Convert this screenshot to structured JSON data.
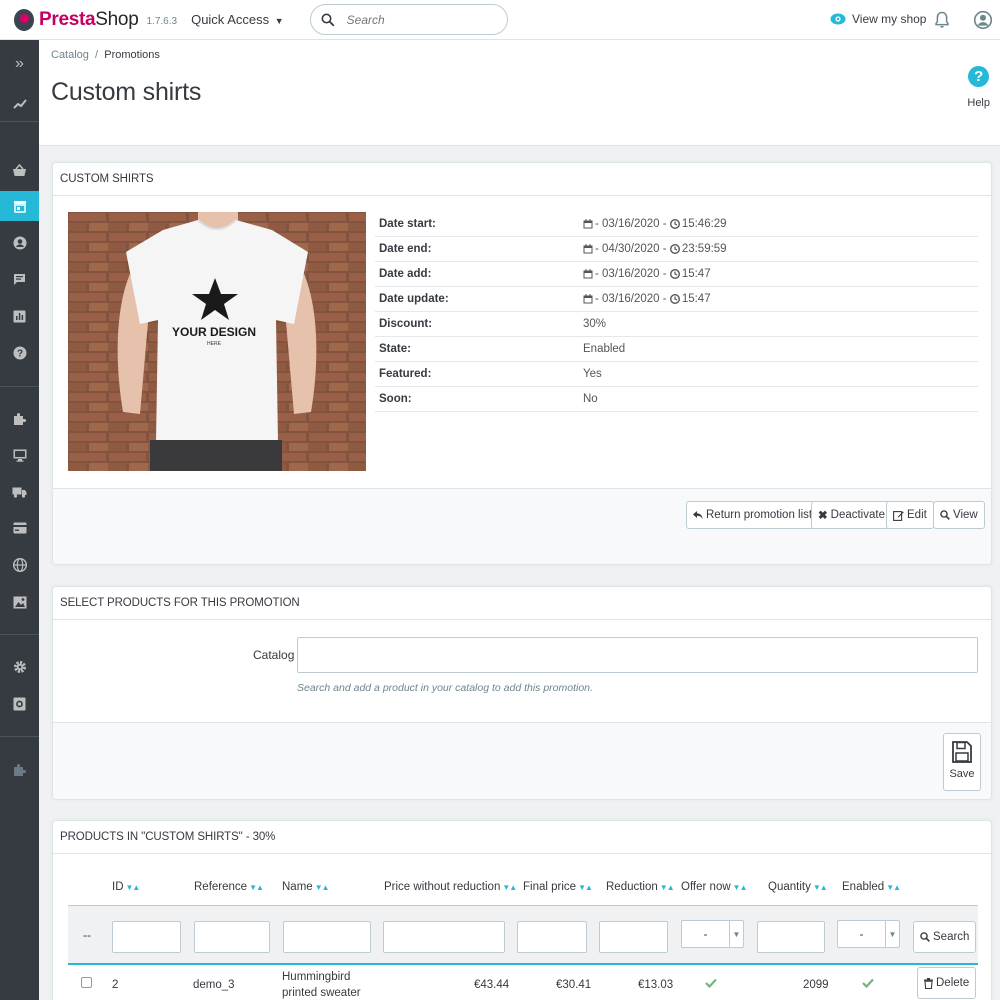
{
  "header": {
    "logo_prefix": "Presta",
    "logo_suffix": "Shop",
    "version": "1.7.6.3",
    "quick_access": "Quick Access",
    "search_placeholder": "Search",
    "view_shop": "View my shop"
  },
  "sidebar": {
    "items": [
      {
        "icon": "chevrons-right-icon"
      },
      {
        "icon": "dashboard-trend-icon"
      },
      {
        "icon": "orders-basket-icon"
      },
      {
        "icon": "catalog-store-icon",
        "active": true
      },
      {
        "icon": "customers-user-icon"
      },
      {
        "icon": "messages-chat-icon"
      },
      {
        "icon": "stats-chart-icon"
      },
      {
        "icon": "help-question-icon"
      },
      {
        "icon": "modules-puzzle-icon"
      },
      {
        "icon": "design-monitor-icon"
      },
      {
        "icon": "shipping-truck-icon"
      },
      {
        "icon": "payment-card-icon"
      },
      {
        "icon": "international-globe-icon"
      },
      {
        "icon": "media-image-icon"
      },
      {
        "icon": "settings-gear-icon"
      },
      {
        "icon": "advanced-settings-icon"
      },
      {
        "icon": "extension-puzzle-icon"
      }
    ]
  },
  "page": {
    "breadcrumb_parent": "Catalog",
    "breadcrumb_sep": "/",
    "breadcrumb_current": "Promotions",
    "title": "Custom shirts",
    "help_label": "Help"
  },
  "promotion": {
    "heading": "CUSTOM SHIRTS",
    "image_text_main": "YOUR DESIGN",
    "image_text_sub": "HERE",
    "rows": [
      {
        "label": "Date start:",
        "date": "- 03/16/2020 -",
        "time": "15:46:29"
      },
      {
        "label": "Date end:",
        "date": "- 04/30/2020 -",
        "time": "23:59:59"
      },
      {
        "label": "Date add:",
        "date": "- 03/16/2020 -",
        "time": "15:47"
      },
      {
        "label": "Date update:",
        "date": "- 03/16/2020 -",
        "time": "15:47"
      },
      {
        "label": "Discount:",
        "value": "30%"
      },
      {
        "label": "State:",
        "value": "Enabled"
      },
      {
        "label": "Featured:",
        "value": "Yes"
      },
      {
        "label": "Soon:",
        "value": "No"
      }
    ],
    "buttons": {
      "return": "Return promotion list",
      "deactivate": "Deactivate",
      "edit": "Edit",
      "view": "View"
    }
  },
  "select_products": {
    "heading": "SELECT PRODUCTS FOR THIS PROMOTION",
    "catalog_label": "Catalog",
    "catalog_help": "Search and add a product in your catalog to add this promotion.",
    "save_label": "Save"
  },
  "products": {
    "heading": "PRODUCTS IN \"CUSTOM SHIRTS\" - 30%",
    "columns": [
      "ID",
      "Reference",
      "Name",
      "Price without reduction",
      "Final price",
      "Reduction",
      "Offer now",
      "Quantity",
      "Enabled"
    ],
    "filter_dash": "--",
    "select_default": "-",
    "search_button": "Search",
    "rows": [
      {
        "id": "2",
        "reference": "demo_3",
        "name_line1": "Hummingbird",
        "name_line2": "printed sweater",
        "price_without_reduction": "€43.44",
        "final_price": "€30.41",
        "reduction": "€13.03",
        "offer_now": true,
        "quantity": "2099",
        "enabled": true,
        "delete_label": "Delete"
      }
    ]
  },
  "colors": {
    "accent": "#25b9d7",
    "sidebar_bg": "#363a41",
    "brand_pink": "#df0067",
    "success": "#70b580"
  }
}
